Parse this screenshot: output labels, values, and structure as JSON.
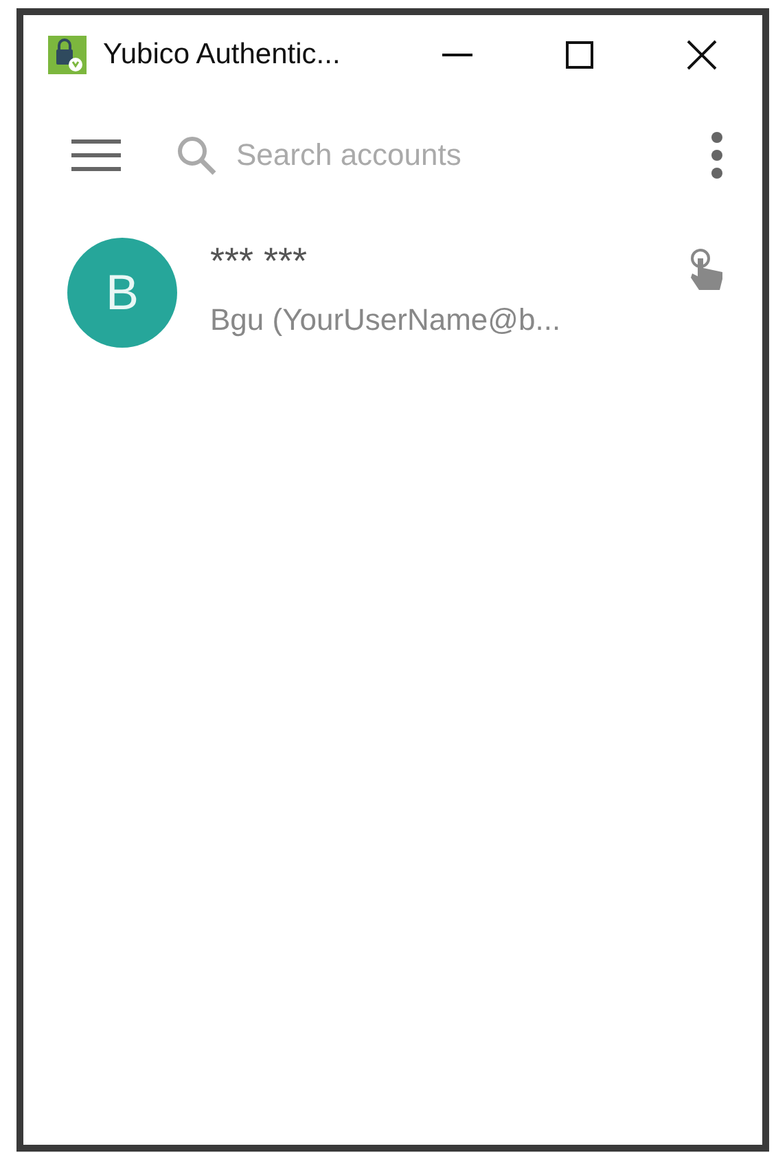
{
  "window": {
    "title": "Yubico Authentic..."
  },
  "toolbar": {
    "search": {
      "placeholder": "Search accounts"
    }
  },
  "accounts": [
    {
      "avatar": "B",
      "name": "*** ***",
      "subtitle": "Bgu (YourUserName@b...",
      "color": "#26a69a",
      "kind": "touch"
    }
  ]
}
